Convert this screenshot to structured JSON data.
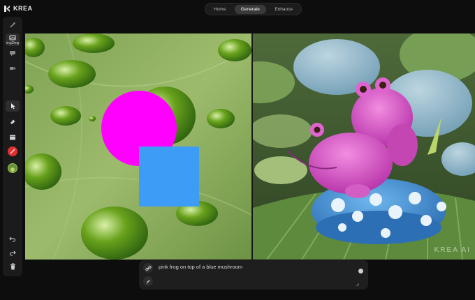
{
  "app": {
    "name": "KREA"
  },
  "nav": {
    "tabs": [
      "Home",
      "Generate",
      "Enhance"
    ],
    "active": "Generate"
  },
  "sidebar": {
    "active_label": "img2img",
    "colors": {
      "brush": "#e03131",
      "image_tool": "#6a8f3a"
    }
  },
  "canvas": {
    "mask_colors": {
      "circle": "#ff00ff",
      "square": "#3d9df6"
    },
    "watermark": "KREA AI"
  },
  "prompt": {
    "text": "pink frog on top of a blue mushroom"
  }
}
